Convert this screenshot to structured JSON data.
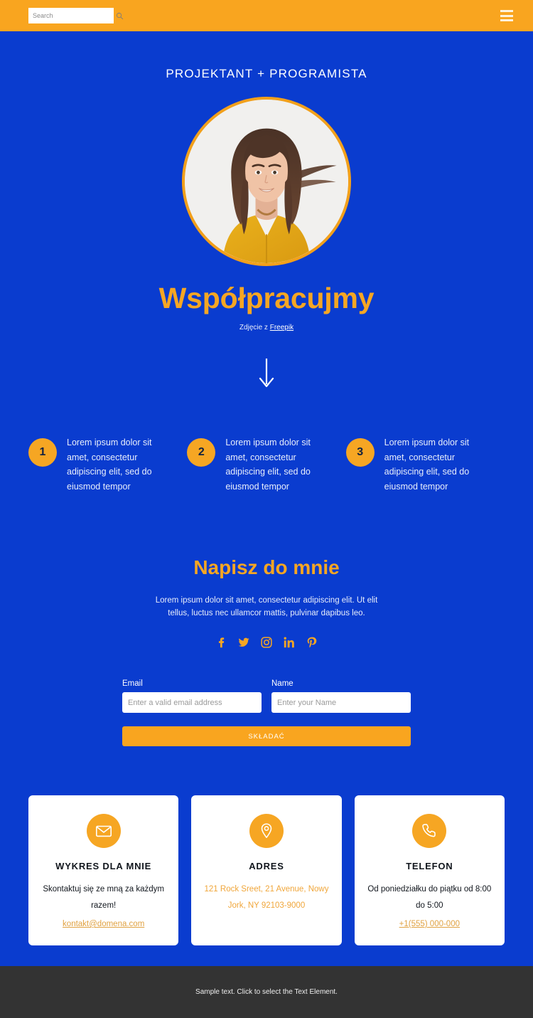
{
  "topbar": {
    "search_placeholder": "Search",
    "search_value": "",
    "search_icon": "search-icon",
    "menu_icon": "hamburger-menu-icon"
  },
  "hero": {
    "eyebrow": "PROJEKTANT + PROGRAMISTA",
    "portrait_alt": "portrait-photo",
    "headline": "Współpracujmy",
    "credit_prefix": "Zdjęcie z ",
    "credit_link": "Freepik",
    "scroll_icon": "arrow-down-icon"
  },
  "steps": [
    {
      "number": "1",
      "text": "Lorem ipsum dolor sit amet, consectetur adipiscing elit, sed do eiusmod tempor"
    },
    {
      "number": "2",
      "text": "Lorem ipsum dolor sit amet, consectetur adipiscing elit, sed do eiusmod tempor"
    },
    {
      "number": "3",
      "text": "Lorem ipsum dolor sit amet, consectetur adipiscing elit, sed do eiusmod tempor"
    }
  ],
  "contact": {
    "title": "Napisz do mnie",
    "subtitle": "Lorem ipsum dolor sit amet, consectetur adipiscing elit. Ut elit tellus, luctus nec ullamcor mattis, pulvinar dapibus leo.",
    "socials": [
      {
        "name": "facebook-icon",
        "label": "Facebook"
      },
      {
        "name": "twitter-icon",
        "label": "Twitter"
      },
      {
        "name": "instagram-icon",
        "label": "Instagram"
      },
      {
        "name": "linkedin-icon",
        "label": "LinkedIn"
      },
      {
        "name": "pinterest-icon",
        "label": "Pinterest"
      }
    ]
  },
  "form": {
    "email_label": "Email",
    "email_placeholder": "Enter a valid email address",
    "email_value": "",
    "name_label": "Name",
    "name_placeholder": "Enter your Name",
    "name_value": "",
    "submit_label": "SKŁADAĆ"
  },
  "cards": [
    {
      "icon": "envelope-icon",
      "title": "WYKRES DLA MNIE",
      "body": "Skontaktuj się ze mną za każdym razem!",
      "body_accent": false,
      "link": "kontakt@domena.com"
    },
    {
      "icon": "map-pin-icon",
      "title": "ADRES",
      "body": "121 Rock Sreet, 21 Avenue, Nowy Jork, NY 92103-9000",
      "body_accent": true,
      "link": ""
    },
    {
      "icon": "phone-icon",
      "title": "TELEFON",
      "body": "Od poniedziałku do piątku od 8:00 do 5:00",
      "body_accent": false,
      "link": "+1(555) 000-000"
    }
  ],
  "footer": {
    "text": "Sample text. Click to select the Text Element."
  },
  "colors": {
    "background_blue": "#0a3ccf",
    "accent_orange": "#f6a623",
    "topbar_orange": "#f9a51f",
    "footer_gray": "#333333",
    "card_white": "#ffffff"
  }
}
